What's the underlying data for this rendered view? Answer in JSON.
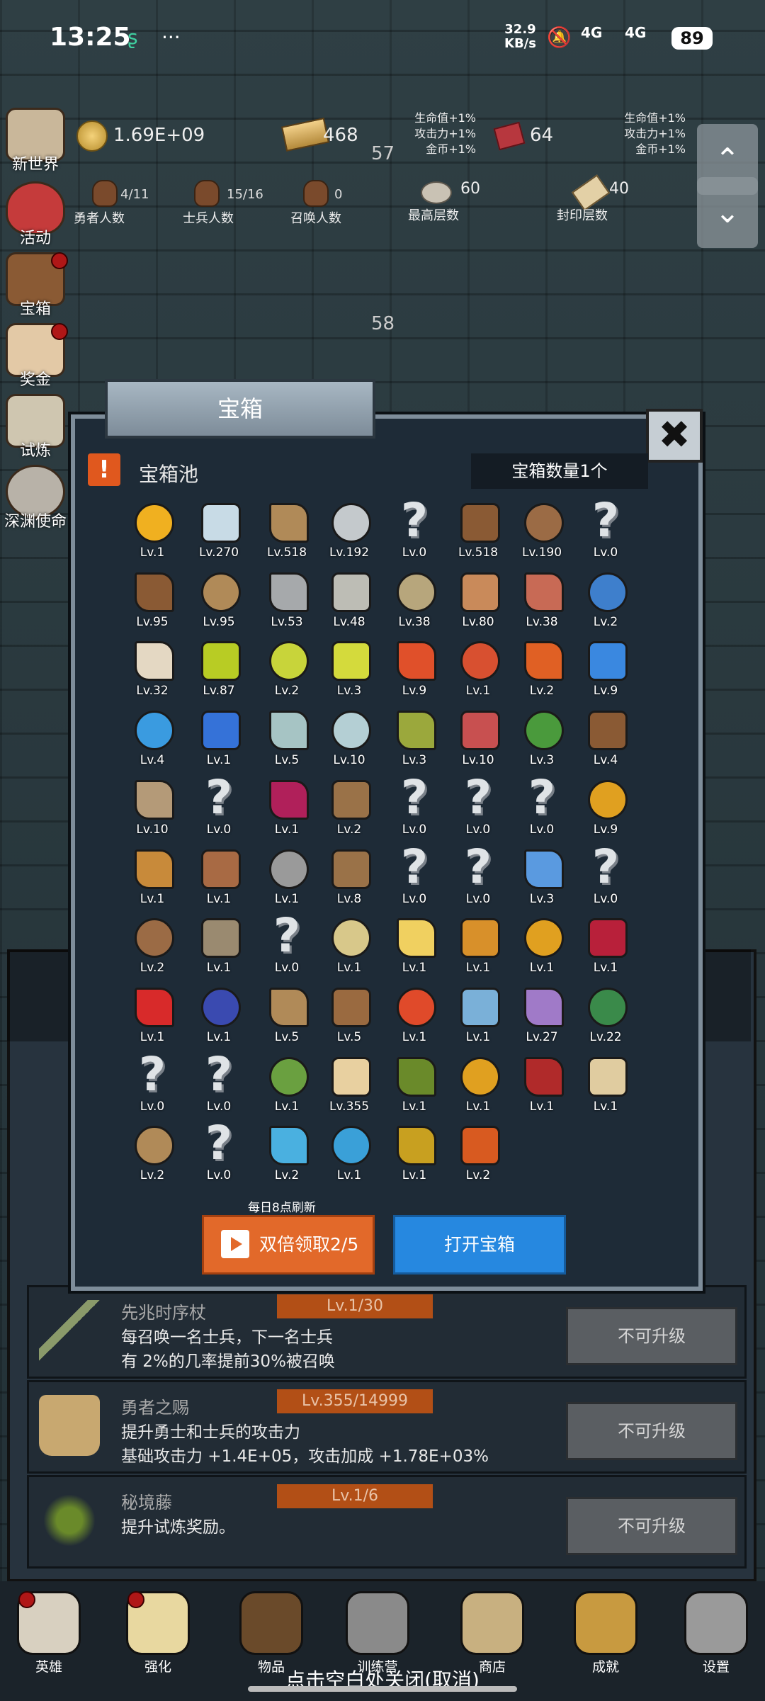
{
  "status_bar": {
    "time": "13:25",
    "dots": "···",
    "speed_value": "32.9",
    "speed_unit": "KB/s",
    "signal1": "4G",
    "signal2": "4G",
    "battery": "89"
  },
  "stats": {
    "gold": "1.69E+09",
    "bars": "468",
    "gems": "64",
    "floor_a": "57",
    "floor_b": "58",
    "buffs1": [
      "生命值+1%",
      "攻击力+1%",
      "金币+1%"
    ],
    "buffs2": [
      "生命值+1%",
      "攻击力+1%",
      "金币+1%"
    ],
    "hero_count": "4/11",
    "hero_label": "勇者人数",
    "soldier_count": "15/16",
    "soldier_label": "士兵人数",
    "summon_count": "0",
    "summon_label": "召唤人数",
    "max_floor": "60",
    "max_floor_label": "最高层数",
    "seal_floor": "40",
    "seal_floor_label": "封印层数"
  },
  "side_menu": [
    {
      "label": "新世界"
    },
    {
      "label": "活动"
    },
    {
      "label": "宝箱"
    },
    {
      "label": "奖金"
    },
    {
      "label": "试炼"
    },
    {
      "label": "深渊使命"
    }
  ],
  "scroll": {
    "up": "⌃",
    "down": "⌄"
  },
  "back_rows": [
    {
      "title": "先兆时序杖",
      "level": "Lv.1/30",
      "desc1": "每召唤一名士兵，下一名士兵",
      "desc2": "有 2%的几率提前30%被召唤",
      "button": "不可升级",
      "icon": "staff-icon"
    },
    {
      "title": "勇者之赐",
      "level": "Lv.355/14999",
      "desc1": "提升勇士和士兵的攻击力",
      "desc2": "基础攻击力 +1.4E+05，攻击加成 +1.78E+03%",
      "button": "不可升级",
      "icon": "mug-icon"
    },
    {
      "title": "秘境藤",
      "level": "Lv.1/6",
      "desc1": "提升试炼奖励。",
      "desc2": "",
      "button": "不可升级",
      "icon": "vine-icon"
    }
  ],
  "modal": {
    "tab_title": "宝箱",
    "close": "✖",
    "pool_icon": "!",
    "pool_title": "宝箱池",
    "chest_count": "宝箱数量1个",
    "refresh_note": "每日8点刷新",
    "double_button": "双倍领取2/5",
    "open_button": "打开宝箱"
  },
  "items": [
    {
      "lv": "Lv.1",
      "icon": "crown-icon",
      "c": "#f0b020"
    },
    {
      "lv": "Lv.270",
      "icon": "diamond-icon",
      "c": "#c8dbe6"
    },
    {
      "lv": "Lv.518",
      "icon": "sword-icon",
      "c": "#b08a58"
    },
    {
      "lv": "Lv.192",
      "icon": "sword-icon",
      "c": "#c4c9cc"
    },
    {
      "lv": "Lv.0",
      "icon": "unknown-icon",
      "c": ""
    },
    {
      "lv": "Lv.518",
      "icon": "armor-icon",
      "c": "#8a5a34"
    },
    {
      "lv": "Lv.190",
      "icon": "backpack-icon",
      "c": "#9b6b45"
    },
    {
      "lv": "Lv.0",
      "icon": "unknown-icon",
      "c": ""
    },
    {
      "lv": "Lv.95",
      "icon": "helmet-icon",
      "c": "#8a5a34"
    },
    {
      "lv": "Lv.95",
      "icon": "dagger-icon",
      "c": "#b08a58"
    },
    {
      "lv": "Lv.53",
      "icon": "helmet-icon",
      "c": "#a6a9ab"
    },
    {
      "lv": "Lv.48",
      "icon": "hammer-icon",
      "c": "#bdbdb5"
    },
    {
      "lv": "Lv.38",
      "icon": "great-helm-icon",
      "c": "#b7a67c"
    },
    {
      "lv": "Lv.80",
      "icon": "ham-icon",
      "c": "#c98a5a"
    },
    {
      "lv": "Lv.38",
      "icon": "steak-icon",
      "c": "#c86a55"
    },
    {
      "lv": "Lv.2",
      "icon": "bag-icon",
      "c": "#3e7fcc"
    },
    {
      "lv": "Lv.32",
      "icon": "bowl-icon",
      "c": "#e4d8c3"
    },
    {
      "lv": "Lv.87",
      "icon": "potion-icon",
      "c": "#b8cc24"
    },
    {
      "lv": "Lv.2",
      "icon": "potion-icon",
      "c": "#c8d43a"
    },
    {
      "lv": "Lv.3",
      "icon": "potion-icon",
      "c": "#d4da3c"
    },
    {
      "lv": "Lv.9",
      "icon": "potion-icon",
      "c": "#e0502a"
    },
    {
      "lv": "Lv.1",
      "icon": "potion-icon",
      "c": "#d85030"
    },
    {
      "lv": "Lv.2",
      "icon": "potion-icon",
      "c": "#e06024"
    },
    {
      "lv": "Lv.9",
      "icon": "potion-icon",
      "c": "#3a88e0"
    },
    {
      "lv": "Lv.4",
      "icon": "potion-icon",
      "c": "#3a9be0"
    },
    {
      "lv": "Lv.1",
      "icon": "potion-icon",
      "c": "#3572d8"
    },
    {
      "lv": "Lv.5",
      "icon": "bottle-icon",
      "c": "#a6c4c4"
    },
    {
      "lv": "Lv.10",
      "icon": "bottle-icon",
      "c": "#b4cfd4"
    },
    {
      "lv": "Lv.3",
      "icon": "bottle-icon",
      "c": "#9ba83c"
    },
    {
      "lv": "Lv.10",
      "icon": "bottle-icon",
      "c": "#c85050"
    },
    {
      "lv": "Lv.3",
      "icon": "winged-boot-icon",
      "c": "#4a9a3c"
    },
    {
      "lv": "Lv.4",
      "icon": "boot-icon",
      "c": "#8a5a34"
    },
    {
      "lv": "Lv.10",
      "icon": "boot-icon",
      "c": "#b49a78"
    },
    {
      "lv": "Lv.0",
      "icon": "unknown-icon",
      "c": ""
    },
    {
      "lv": "Lv.1",
      "icon": "magic-boot-icon",
      "c": "#b0205a"
    },
    {
      "lv": "Lv.2",
      "icon": "shield-icon",
      "c": "#9a7248"
    },
    {
      "lv": "Lv.0",
      "icon": "unknown-icon",
      "c": ""
    },
    {
      "lv": "Lv.0",
      "icon": "unknown-icon",
      "c": ""
    },
    {
      "lv": "Lv.0",
      "icon": "unknown-icon",
      "c": ""
    },
    {
      "lv": "Lv.9",
      "icon": "torch-icon",
      "c": "#e0a020"
    },
    {
      "lv": "Lv.1",
      "icon": "torch-icon",
      "c": "#c88a3a"
    },
    {
      "lv": "Lv.1",
      "icon": "mushroom-icon",
      "c": "#a86a44"
    },
    {
      "lv": "Lv.1",
      "icon": "pickaxe-icon",
      "c": "#9a9a9a"
    },
    {
      "lv": "Lv.8",
      "icon": "staff-icon",
      "c": "#9a7248"
    },
    {
      "lv": "Lv.0",
      "icon": "unknown-icon",
      "c": ""
    },
    {
      "lv": "Lv.0",
      "icon": "unknown-icon",
      "c": ""
    },
    {
      "lv": "Lv.3",
      "icon": "wand-icon",
      "c": "#5a9ae0"
    },
    {
      "lv": "Lv.0",
      "icon": "unknown-icon",
      "c": ""
    },
    {
      "lv": "Lv.2",
      "icon": "backpack-icon",
      "c": "#9b6b45"
    },
    {
      "lv": "Lv.1",
      "icon": "shovel-icon",
      "c": "#9a8a70"
    },
    {
      "lv": "Lv.0",
      "icon": "unknown-icon",
      "c": ""
    },
    {
      "lv": "Lv.1",
      "icon": "spear-icon",
      "c": "#d8c88a"
    },
    {
      "lv": "Lv.1",
      "icon": "cheese-icon",
      "c": "#f0d060"
    },
    {
      "lv": "Lv.1",
      "icon": "pie-icon",
      "c": "#d8902a"
    },
    {
      "lv": "Lv.1",
      "icon": "jar-icon",
      "c": "#e0a020"
    },
    {
      "lv": "Lv.1",
      "icon": "crystal-icon",
      "c": "#b8203a"
    },
    {
      "lv": "Lv.1",
      "icon": "orb-icon",
      "c": "#d82a2a"
    },
    {
      "lv": "Lv.1",
      "icon": "gem-amulet-icon",
      "c": "#3a4ab0"
    },
    {
      "lv": "Lv.5",
      "icon": "bow-icon",
      "c": "#b08a58"
    },
    {
      "lv": "Lv.5",
      "icon": "quiver-icon",
      "c": "#9a6a40"
    },
    {
      "lv": "Lv.1",
      "icon": "flower-icon",
      "c": "#e04a2a"
    },
    {
      "lv": "Lv.1",
      "icon": "spirit-icon",
      "c": "#7ab0d8"
    },
    {
      "lv": "Lv.27",
      "icon": "spirit-icon",
      "c": "#a07ac8"
    },
    {
      "lv": "Lv.22",
      "icon": "emblem-icon",
      "c": "#3a8a4a"
    },
    {
      "lv": "Lv.0",
      "icon": "unknown-icon",
      "c": ""
    },
    {
      "lv": "Lv.0",
      "icon": "unknown-icon",
      "c": ""
    },
    {
      "lv": "Lv.1",
      "icon": "staff-icon",
      "c": "#6aa040"
    },
    {
      "lv": "Lv.355",
      "icon": "mug-icon",
      "c": "#e8d0a0"
    },
    {
      "lv": "Lv.1",
      "icon": "vine-icon",
      "c": "#6a8a2a"
    },
    {
      "lv": "Lv.1",
      "icon": "golden-pickaxe-icon",
      "c": "#e0a020"
    },
    {
      "lv": "Lv.1",
      "icon": "book-icon",
      "c": "#b02a2a"
    },
    {
      "lv": "Lv.1",
      "icon": "scroll-icon",
      "c": "#e0cca0"
    },
    {
      "lv": "Lv.2",
      "icon": "whip-icon",
      "c": "#b08a58"
    },
    {
      "lv": "Lv.0",
      "icon": "unknown-icon",
      "c": ""
    },
    {
      "lv": "Lv.2",
      "icon": "crystal-ball-icon",
      "c": "#4ab0e0"
    },
    {
      "lv": "Lv.1",
      "icon": "rune-orb-icon",
      "c": "#3aa0d8"
    },
    {
      "lv": "Lv.1",
      "icon": "golden-orb-icon",
      "c": "#c8a020"
    },
    {
      "lv": "Lv.2",
      "icon": "arrow-icon",
      "c": "#d85a20"
    }
  ],
  "nav": [
    {
      "label": "英雄",
      "icon": "skull-icon",
      "c": "#d8d0c0",
      "dot": true
    },
    {
      "label": "强化",
      "icon": "candle-icon",
      "c": "#e8d8a0",
      "dot": true
    },
    {
      "label": "物品",
      "icon": "book-icon",
      "c": "#6a4a2a",
      "dot": false
    },
    {
      "label": "训练营",
      "icon": "lantern-icon",
      "c": "#8a8a8a",
      "dot": false
    },
    {
      "label": "商店",
      "icon": "mug-icon",
      "c": "#c8b080",
      "dot": false
    },
    {
      "label": "成就",
      "icon": "key-icon",
      "c": "#c89a40",
      "dot": false
    },
    {
      "label": "设置",
      "icon": "gear-icon",
      "c": "#9a9a9a",
      "dot": false
    }
  ],
  "close_hint": "点击空白处关闭(取消)"
}
